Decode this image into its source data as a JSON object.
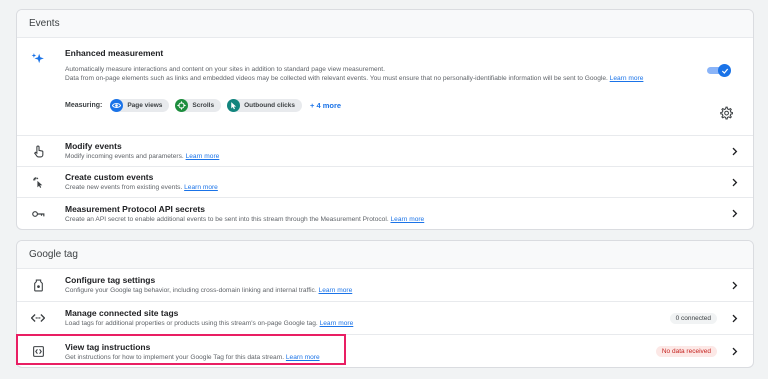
{
  "events": {
    "header": "Events",
    "enhanced": {
      "title": "Enhanced measurement",
      "desc_line1": "Automatically measure interactions and content on your sites in addition to standard page view measurement.",
      "desc_line2": "Data from on-page elements such as links and embedded videos may be collected with relevant events. You must ensure that no personally-identifiable information will be sent to Google.",
      "learn_more": "Learn more",
      "measuring_label": "Measuring:",
      "chips": [
        {
          "label": "Page views",
          "icon": "eye-icon",
          "color": "#1a73e8"
        },
        {
          "label": "Scrolls",
          "icon": "crosshair-icon",
          "color": "#1e8e3e"
        },
        {
          "label": "Outbound clicks",
          "icon": "pointer-icon",
          "color": "#12857e"
        }
      ],
      "more_label": "+ 4 more",
      "toggle_on": true
    },
    "rows": [
      {
        "title": "Modify events",
        "sub": "Modify incoming events and parameters.",
        "link": "Learn more"
      },
      {
        "title": "Create custom events",
        "sub": "Create new events from existing events.",
        "link": "Learn more"
      },
      {
        "title": "Measurement Protocol API secrets",
        "sub": "Create an API secret to enable additional events to be sent into this stream through the Measurement Protocol.",
        "link": "Learn more"
      }
    ]
  },
  "google_tag": {
    "header": "Google tag",
    "rows": [
      {
        "title": "Configure tag settings",
        "sub": "Configure your Google tag behavior, including cross-domain linking and internal traffic.",
        "link": "Learn more"
      },
      {
        "title": "Manage connected site tags",
        "sub": "Load tags for additional properties or products using this stream's on-page Google tag.",
        "link": "Learn more",
        "badge": "0 connected"
      },
      {
        "title": "View tag instructions",
        "sub": "Get instructions for how to implement your Google Tag for this data stream.",
        "link": "Learn more",
        "badge": "No data received"
      }
    ]
  },
  "colors": {
    "accent": "#1a73e8",
    "highlight": "#e91e63",
    "warning": "#c5221f"
  }
}
